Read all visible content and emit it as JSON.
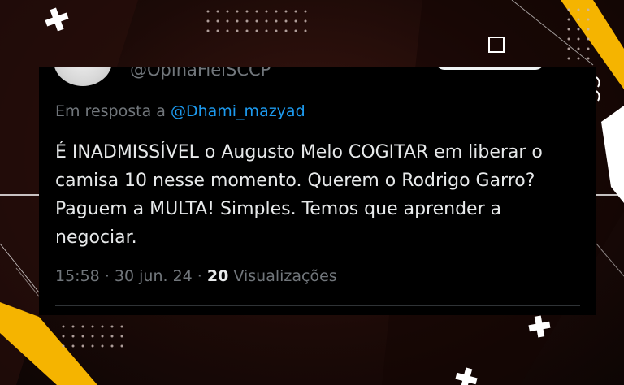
{
  "tweet": {
    "author_handle": "@OpinaFielSCCP",
    "reply_prefix": "Em resposta a",
    "reply_to": "@Dhami_mazyad",
    "text": "É INADMISSÍVEL o Augusto Melo COGITAR em liberar o camisa 10 nesse momento. Querem o Rodrigo Garro? Paguem a MULTA! Simples. Temos que aprender a negociar.",
    "time": "15:58",
    "date": "30 jun. 24",
    "views_count": "20",
    "views_label": "Visualizações",
    "separator": "·"
  },
  "colors": {
    "card_bg": "#000000",
    "text_primary": "#e7e9ea",
    "text_secondary": "#71767b",
    "link": "#1d9bf0",
    "accent_yellow": "#f5b400"
  },
  "icons": {
    "close": "close-icon",
    "plus": "plus-icon"
  }
}
